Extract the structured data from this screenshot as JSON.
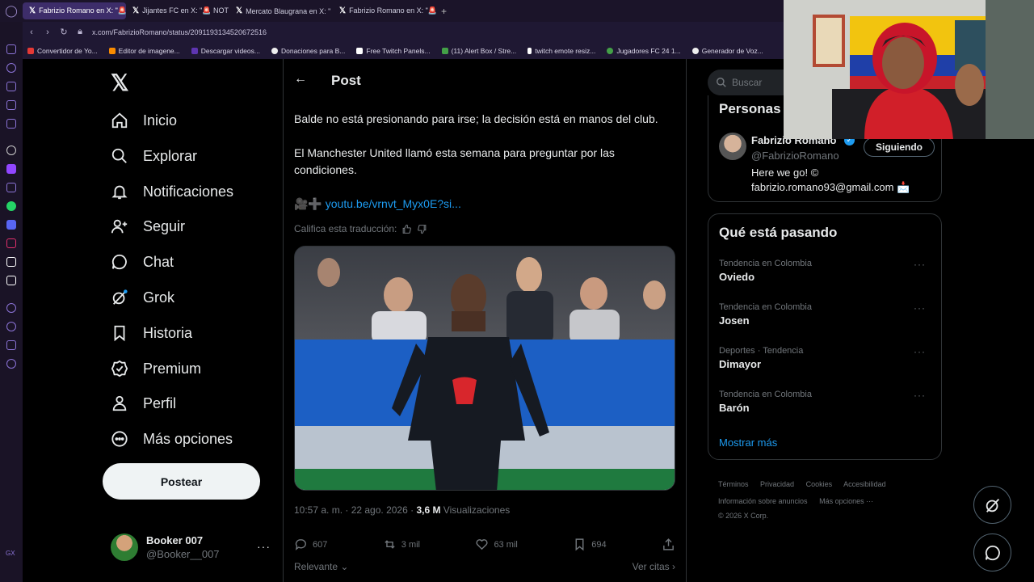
{
  "browser": {
    "tabs": [
      {
        "label": "Fabrizio Romano en X: \"🚨",
        "active": true
      },
      {
        "label": "Jijantes FC en X: \"🚨 NOT",
        "active": false
      },
      {
        "label": "Mercato Blaugrana en X: \"",
        "active": false
      },
      {
        "label": "Fabrizio Romano en X: \"🚨 (",
        "active": false
      }
    ],
    "url": "x.com/FabrizioRomano/status/2091193134520672516",
    "bookmarks": [
      {
        "label": "Convertidor de Yo...",
        "color": "#e53935"
      },
      {
        "label": "Editor de imagene...",
        "color": "#fb8c00"
      },
      {
        "label": "Descargar videos...",
        "color": "#5e35b1"
      },
      {
        "label": "Donaciones para B...",
        "color": "#eeeeee"
      },
      {
        "label": "Free Twitch Panels...",
        "color": "#ffffff"
      },
      {
        "label": "(11) Alert Box / Stre...",
        "color": "#43a047"
      },
      {
        "label": "twitch emote resiz...",
        "color": "#ffffff"
      },
      {
        "label": "Jugadores FC 24 1...",
        "color": "#43a047"
      },
      {
        "label": "Generador de Voz...",
        "color": "#eeeeee"
      }
    ]
  },
  "nav": {
    "items": [
      {
        "label": "Inicio",
        "icon": "home-icon"
      },
      {
        "label": "Explorar",
        "icon": "search-icon"
      },
      {
        "label": "Notificaciones",
        "icon": "bell-icon"
      },
      {
        "label": "Seguir",
        "icon": "follow-icon"
      },
      {
        "label": "Chat",
        "icon": "chat-icon"
      },
      {
        "label": "Grok",
        "icon": "grok-icon"
      },
      {
        "label": "Historia",
        "icon": "bookmark-icon"
      },
      {
        "label": "Premium",
        "icon": "verified-icon"
      },
      {
        "label": "Perfil",
        "icon": "profile-icon"
      },
      {
        "label": "Más opciones",
        "icon": "more-icon"
      }
    ],
    "post_button": "Postear",
    "user": {
      "name": "Booker 007",
      "handle": "@Booker__007"
    }
  },
  "post": {
    "header": "Post",
    "text_1": "Balde no está presionando para irse; la decisión está en manos del club.",
    "text_2": "El Manchester United llamó esta semana para preguntar por las condiciones.",
    "link_prefix": "🎥➕ ",
    "link": "youtu.be/vrnvt_Myx0E?si...",
    "rate_translation": "Califica esta traducción:",
    "time": "10:57 a. m. · 22 ago. 2026 · ",
    "views_count": "3,6 M",
    "views_label": " Visualizaciones",
    "replies": "607",
    "reposts": "3 mil",
    "likes": "63 mil",
    "bookmarks": "694",
    "sort": "Relevante",
    "quotes": "Ver citas"
  },
  "right": {
    "search_placeholder": "Buscar",
    "people_title": "Personas r",
    "profile": {
      "name": "Fabrizio Romano",
      "handle": "@FabrizioRomano",
      "follow_label": "Siguiendo",
      "bio": "Here we go! ©",
      "email": "fabrizio.romano93@gmail.com 📩"
    },
    "trending_title": "Qué está pasando",
    "trends": [
      {
        "category": "Tendencia en Colombia",
        "name": "Oviedo"
      },
      {
        "category": "Tendencia en Colombia",
        "name": "Josen"
      },
      {
        "category": "Deportes · Tendencia",
        "name": "Dimayor"
      },
      {
        "category": "Tendencia en Colombia",
        "name": "Barón"
      }
    ],
    "show_more": "Mostrar más",
    "footer": {
      "terms": "Términos",
      "privacy": "Privacidad",
      "cookies": "Cookies",
      "accessibility": "Accesibilidad",
      "ads": "Información sobre anuncios",
      "more": "Más opciones ···",
      "copyright": "© 2026 X Corp."
    }
  },
  "colors": {
    "accent": "#1d9bf0",
    "background": "#000000",
    "opera_purple": "#3d2d6a"
  }
}
